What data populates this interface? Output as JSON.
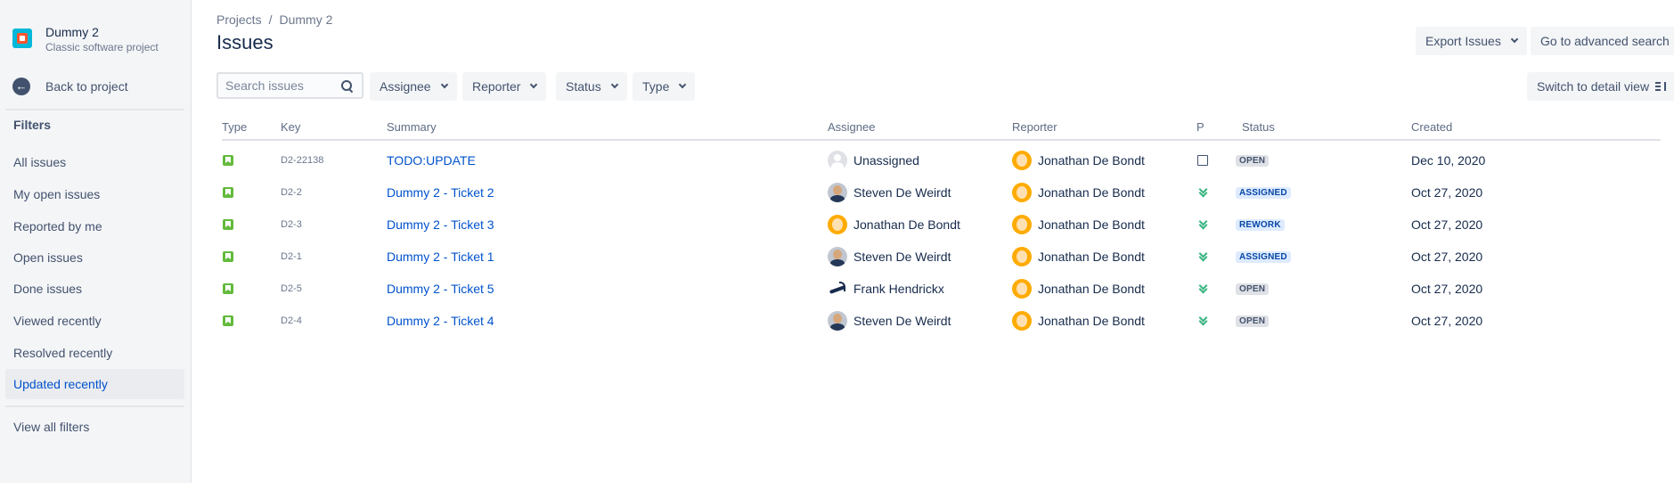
{
  "sidebar": {
    "project_name": "Dummy 2",
    "project_type": "Classic software project",
    "back_label": "Back to project",
    "filters_heading": "Filters",
    "items": [
      {
        "label": "All issues",
        "active": false
      },
      {
        "label": "My open issues",
        "active": false
      },
      {
        "label": "Reported by me",
        "active": false
      },
      {
        "label": "Open issues",
        "active": false
      },
      {
        "label": "Done issues",
        "active": false
      },
      {
        "label": "Viewed recently",
        "active": false
      },
      {
        "label": "Resolved recently",
        "active": false
      },
      {
        "label": "Updated recently",
        "active": true
      }
    ],
    "view_all_filters": "View all filters"
  },
  "header": {
    "breadcrumb": [
      "Projects",
      "/",
      "Dummy 2"
    ],
    "title": "Issues",
    "export_label": "Export Issues",
    "advanced_search_label": "Go to advanced search"
  },
  "toolbar": {
    "search_placeholder": "Search issues",
    "filters": [
      "Assignee",
      "Reporter",
      "Status",
      "Type"
    ],
    "detail_view_label": "Switch to detail view"
  },
  "table": {
    "columns": [
      "Type",
      "Key",
      "Summary",
      "Assignee",
      "Reporter",
      "P",
      "Status",
      "Created"
    ],
    "rows": [
      {
        "type": "story",
        "key": "D2-22138",
        "summary": "TODO:UPDATE",
        "assignee": "Unassigned",
        "assignee_avatar": "unassigned",
        "reporter": "Jonathan De Bondt",
        "reporter_avatar": "jonathan",
        "priority": "trivial",
        "status": "OPEN",
        "status_color": "grey",
        "created": "Dec 10, 2020"
      },
      {
        "type": "story",
        "key": "D2-2",
        "summary": "Dummy 2 - Ticket 2",
        "assignee": "Steven De Weirdt",
        "assignee_avatar": "steven",
        "reporter": "Jonathan De Bondt",
        "reporter_avatar": "jonathan",
        "priority": "low",
        "status": "ASSIGNED",
        "status_color": "blue",
        "created": "Oct 27, 2020"
      },
      {
        "type": "story",
        "key": "D2-3",
        "summary": "Dummy 2 - Ticket 3",
        "assignee": "Jonathan De Bondt",
        "assignee_avatar": "jonathan",
        "reporter": "Jonathan De Bondt",
        "reporter_avatar": "jonathan",
        "priority": "low",
        "status": "REWORK",
        "status_color": "blue",
        "created": "Oct 27, 2020"
      },
      {
        "type": "story",
        "key": "D2-1",
        "summary": "Dummy 2 - Ticket 1",
        "assignee": "Steven De Weirdt",
        "assignee_avatar": "steven",
        "reporter": "Jonathan De Bondt",
        "reporter_avatar": "jonathan",
        "priority": "low",
        "status": "ASSIGNED",
        "status_color": "blue",
        "created": "Oct 27, 2020"
      },
      {
        "type": "story",
        "key": "D2-5",
        "summary": "Dummy 2 - Ticket 5",
        "assignee": "Frank Hendrickx",
        "assignee_avatar": "frank",
        "reporter": "Jonathan De Bondt",
        "reporter_avatar": "jonathan",
        "priority": "low",
        "status": "OPEN",
        "status_color": "grey",
        "created": "Oct 27, 2020"
      },
      {
        "type": "story",
        "key": "D2-4",
        "summary": "Dummy 2 - Ticket 4",
        "assignee": "Steven De Weirdt",
        "assignee_avatar": "steven",
        "reporter": "Jonathan De Bondt",
        "reporter_avatar": "jonathan",
        "priority": "low",
        "status": "OPEN",
        "status_color": "grey",
        "created": "Oct 27, 2020"
      }
    ]
  },
  "colors": {
    "link": "#0052cc",
    "sidebar_bg": "#f4f5f7",
    "active_item_bg": "#ebecf0",
    "story_icon": "#63ba3c",
    "priority_low": "#36b37e"
  },
  "icons": {
    "project": "project-avatar-icon",
    "back": "arrow-left-circle-icon",
    "search": "search-icon",
    "chevron": "chevron-down-icon",
    "detail_view": "detail-view-icon",
    "story": "story-icon",
    "priority_trivial": "priority-trivial-icon",
    "priority_low": "priority-low-icon"
  }
}
